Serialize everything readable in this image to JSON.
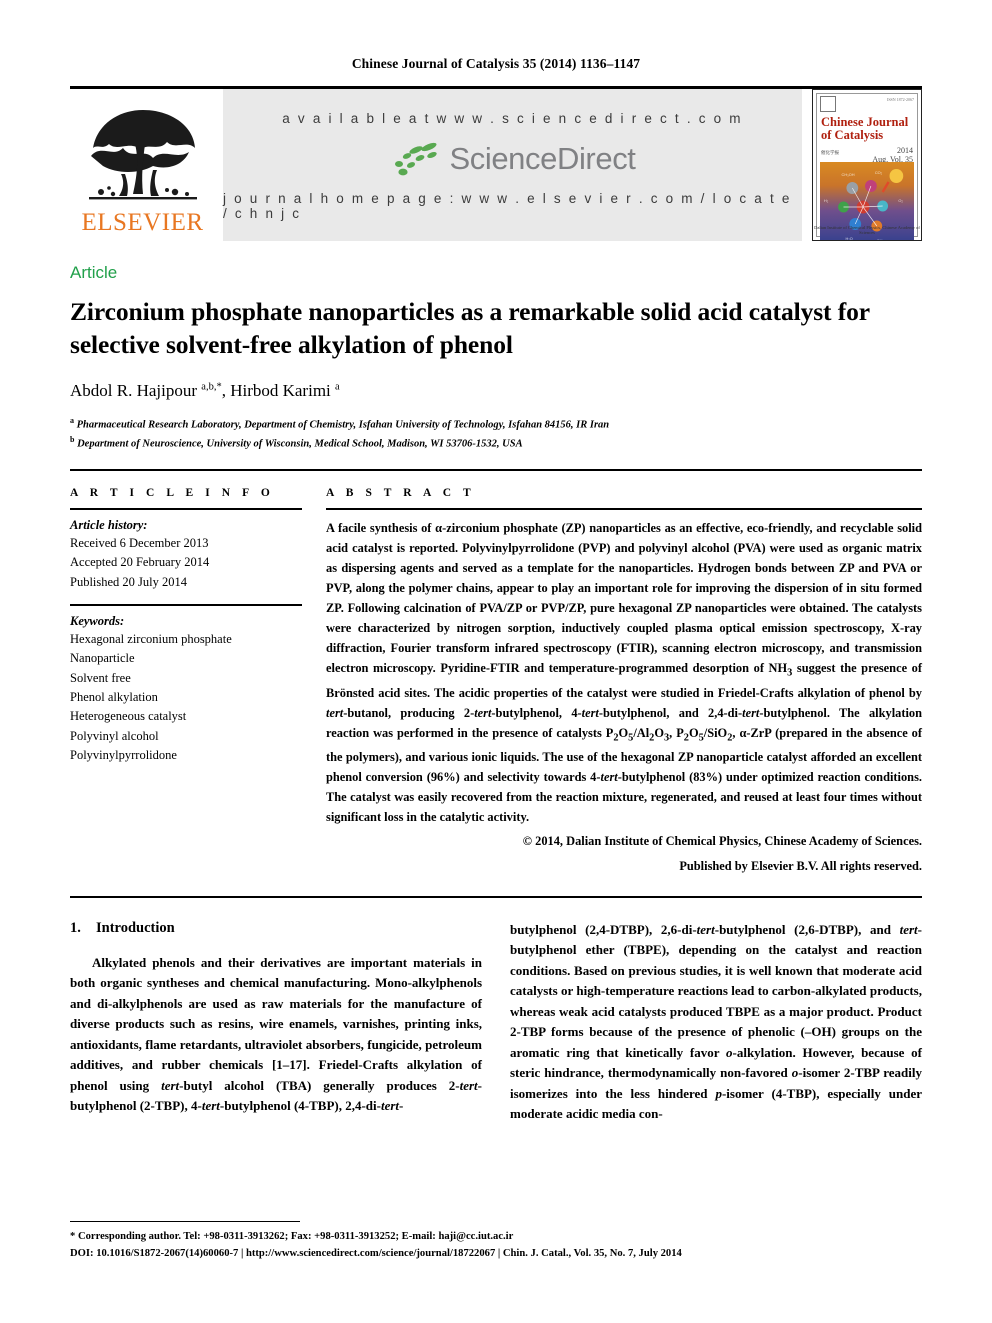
{
  "running_head": "Chinese Journal of Catalysis 35 (2014) 1136–1147",
  "masthead": {
    "publisher_name": "ELSEVIER",
    "available_at": "a v a i l a b l e   a t   w w w . s c i e n c e d i r e c t . c o m",
    "sciencedirect_word": "ScienceDirect",
    "journal_homepage": "j o u r n a l   h o m e p a g e :   w w w . e l s e v i e r . c o m / l o c a t e / c h n j c",
    "cover": {
      "title_line1": "Chinese Journal",
      "title_line2": "of Catalysis",
      "year": "2014",
      "volume_note": "Aug. Vol. 35",
      "subtitle": "催化学报",
      "issn": "ISSN 1872-2067",
      "footer": "Dalian Institute of Chemical Physics, Chinese Academy of Sciences"
    }
  },
  "article": {
    "type": "Article",
    "title": "Zirconium phosphate nanoparticles as a remarkable solid acid catalyst for selective solvent-free alkylation of phenol",
    "authors_html": "Abdol R. Hajipour <sup>a,b,</sup><sup>*</sup>, Hirbod Karimi <sup>a</sup>",
    "affiliations": [
      {
        "marker": "a",
        "text": "Pharmaceutical Research Laboratory, Department of Chemistry, Isfahan University of Technology, Isfahan 84156, IR Iran"
      },
      {
        "marker": "b",
        "text": "Department of Neuroscience, University of Wisconsin, Medical School, Madison, WI 53706-1532, USA"
      }
    ]
  },
  "article_info": {
    "heading": "A R T I C L E   I N F O",
    "history_title": "Article history:",
    "history": [
      "Received 6 December 2013",
      "Accepted 20 February 2014",
      "Published 20 July 2014"
    ],
    "keywords_title": "Keywords:",
    "keywords": [
      "Hexagonal zirconium phosphate",
      "Nanoparticle",
      "Solvent free",
      "Phenol alkylation",
      "Heterogeneous catalyst",
      "Polyvinyl alcohol",
      "Polyvinylpyrrolidone"
    ]
  },
  "abstract": {
    "heading": "A B S T R A C T",
    "text_html": "A facile synthesis of α-zirconium phosphate (ZP) nanoparticles as an effective, eco-friendly, and recyclable solid acid catalyst is reported. Polyvinylpyrrolidone (PVP) and polyvinyl alcohol (PVA) were used as organic matrix as dispersing agents and served as a template for the nanoparticles. Hydrogen bonds between ZP and PVA or PVP, along the polymer chains, appear to play an important role for improving the dispersion of in situ formed ZP. Following calcination of PVA/ZP or PVP/ZP, pure hexagonal ZP nanoparticles were obtained. The catalysts were characterized by nitrogen sorption, inductively coupled plasma optical emission spectroscopy, X-ray diffraction, Fourier transform infrared spectroscopy (FTIR), scanning electron microscopy, and transmission electron microscopy. Pyridine-FTIR and temperature-programmed desorption of NH<sub>3</sub> suggest the presence of Brönsted acid sites. The acidic properties of the catalyst were studied in Friedel-Crafts alkylation of phenol by <i>tert</i>-butanol, producing 2-<i>tert</i>-butylphenol, 4-<i>tert</i>-butylphenol, and 2,4-di-<i>tert</i>-butylphenol. The alkylation reaction was performed in the presence of catalysts P<sub>2</sub>O<sub>5</sub>/Al<sub>2</sub>O<sub>3</sub>, P<sub>2</sub>O<sub>5</sub>/SiO<sub>2</sub>, α-ZrP (prepared in the absence of the polymers), and various ionic liquids. The use of the hexagonal ZP nanoparticle catalyst afforded an excellent phenol conversion (96%) and selectivity towards 4-<i>tert</i>-butylphenol (83%) under optimized reaction conditions. The catalyst was easily recovered from the reaction mixture, regenerated, and reused at least four times without significant loss in the catalytic activity.",
    "copyright_line1": "© 2014, Dalian Institute of Chemical Physics, Chinese Academy of Sciences.",
    "copyright_line2": "Published by Elsevier B.V. All rights reserved."
  },
  "introduction": {
    "number": "1.",
    "heading": "Introduction",
    "left_paragraph_html": "Alkylated phenols and their derivatives are important materials in both organic syntheses and chemical manufacturing. Mono-alkylphenols and di-alkylphenols are used as raw materials for the manufacture of diverse products such as resins, wire enamels, varnishes, printing inks, antioxidants, flame retardants, ultraviolet absorbers, fungicide, petroleum additives, and rubber chemicals [1–17]. Friedel-Crafts alkylation of phenol using <i>tert</i>-butyl alcohol (TBA) generally produces 2-<i>tert</i>-butylphenol (2-TBP), 4-<i>tert</i>-butylphenol (4-TBP), 2,4-di-<i>tert</i>-",
    "right_paragraph_html": "butylphenol (2,4-DTBP), 2,6-di-<i>tert</i>-butylphenol (2,6-DTBP), and <i>tert</i>-butylphenol ether (TBPE), depending on the catalyst and reaction conditions. Based on previous studies, it is well known that moderate acid catalysts or high-temperature reactions lead to carbon-alkylated products, whereas weak acid catalysts produced TBPE as a major product. Product 2-TBP forms because of the presence of phenolic (–OH) groups on the aromatic ring that kinetically favor <i>o</i>-alkylation. However, because of steric hindrance, thermodynamically non-favored <i>o</i>-isomer 2-TBP readily isomerizes into the less hindered <i>p</i>-isomer (4-TBP), especially under moderate acidic media con-"
  },
  "footer": {
    "corresponding_html": "* Corresponding author. Tel: +98-0311-3913262; Fax: +98-0311-3913252; E-mail: haji@cc.iut.ac.ir",
    "doi_line": "DOI: 10.1016/S1872-2067(14)60060-7 | http://www.sciencedirect.com/science/journal/18722067 | Chin. J. Catal., Vol. 35, No. 7, July 2014"
  },
  "colors": {
    "elsevier_orange": "#E87722",
    "article_green": "#21a04a",
    "sciencedirect_gray": "#808184",
    "band_gray": "#e9e9e9",
    "cover_red": "#b0200f"
  }
}
